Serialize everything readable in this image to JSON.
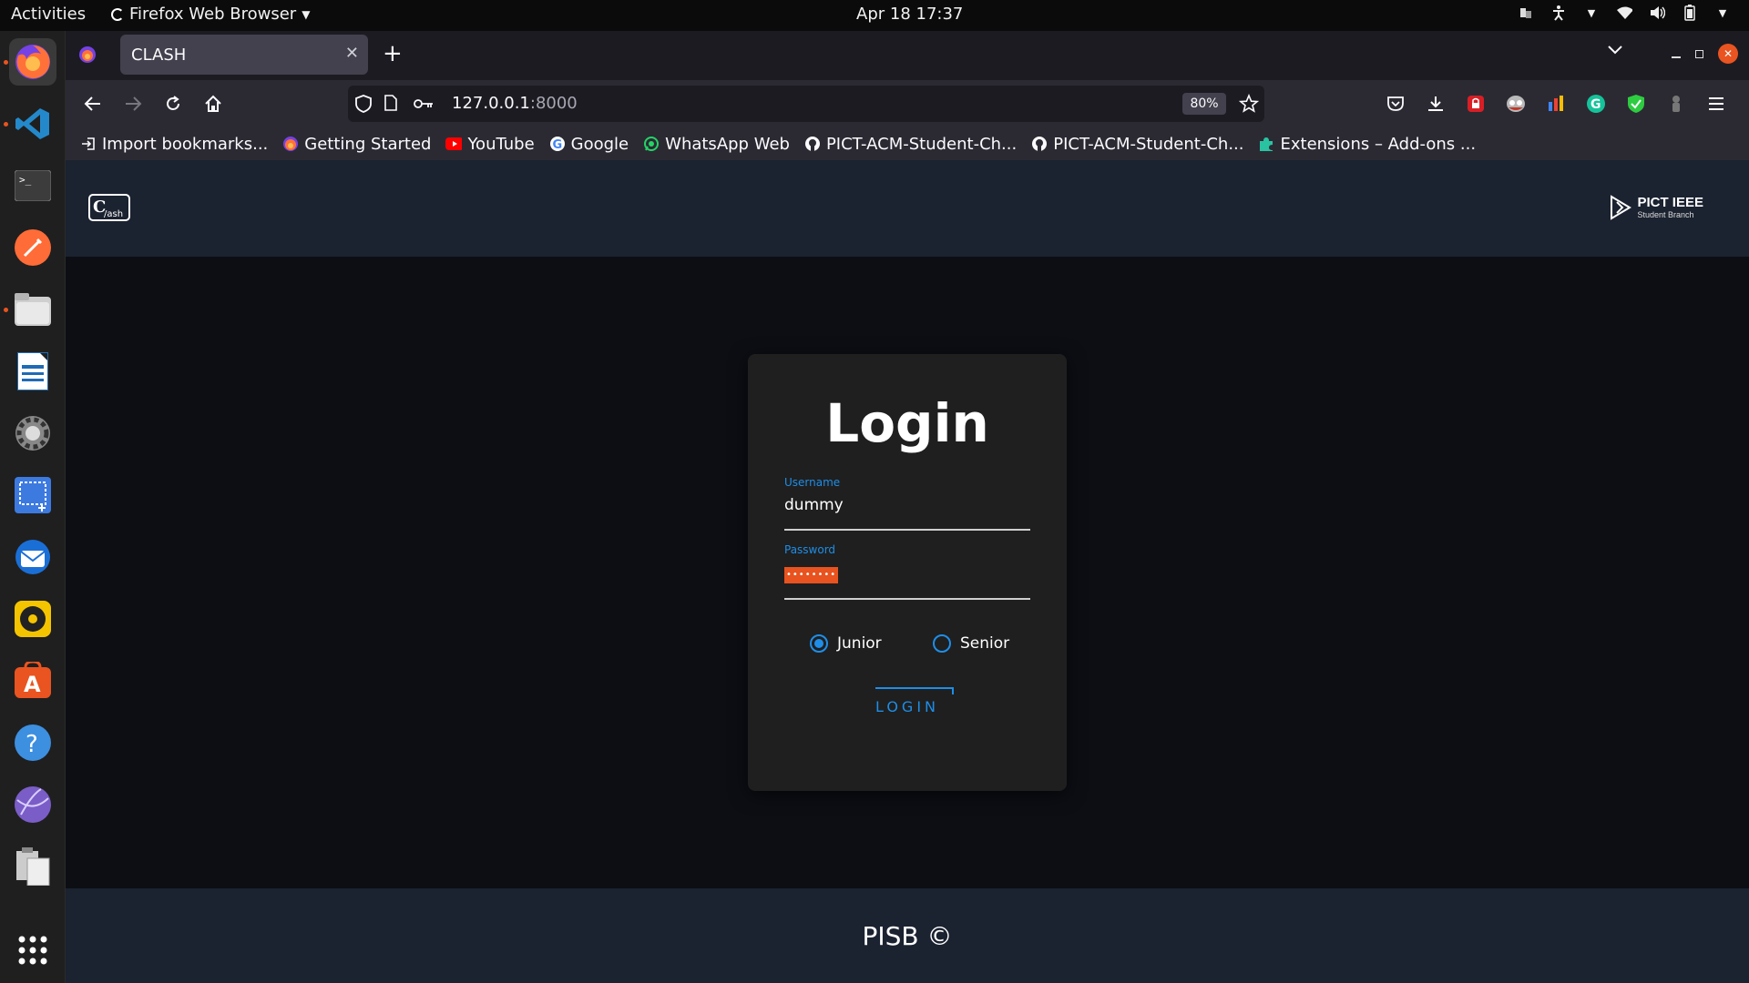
{
  "topbar": {
    "activities": "Activities",
    "app_name": "Firefox Web Browser",
    "clock": "Apr 18  17:37"
  },
  "dock": {
    "items": [
      "firefox",
      "vscode",
      "terminal",
      "postman",
      "files",
      "writer",
      "settings",
      "screenshot",
      "thunderbird",
      "rhythmbox",
      "app-center",
      "help",
      "internet",
      "clipboard",
      "show-apps"
    ]
  },
  "browser": {
    "tab_title": "CLASH",
    "url_host": "127.0.0.1",
    "url_port": ":8000",
    "zoom": "80%"
  },
  "bookmarks": [
    {
      "label": "Import bookmarks...",
      "icon": "import-icon"
    },
    {
      "label": "Getting Started",
      "icon": "firefox-icon"
    },
    {
      "label": "YouTube",
      "icon": "youtube-icon"
    },
    {
      "label": "Google",
      "icon": "google-icon"
    },
    {
      "label": "WhatsApp Web",
      "icon": "whatsapp-icon"
    },
    {
      "label": "PICT-ACM-Student-Ch...",
      "icon": "github-icon"
    },
    {
      "label": "PICT-ACM-Student-Ch...",
      "icon": "github-icon"
    },
    {
      "label": "Extensions – Add-ons ...",
      "icon": "puzzle-icon"
    }
  ],
  "site": {
    "header_logo": "C/ash",
    "ieee_title": "PICT IEEE",
    "ieee_sub": "Student Branch",
    "footer": "PISB ©"
  },
  "login": {
    "title": "Login",
    "username_label": "Username",
    "username_value": "dummy",
    "password_label": "Password",
    "password_mask": "••••••••",
    "radio_junior": "Junior",
    "radio_senior": "Senior",
    "selected": "Junior",
    "button": "LOGIN"
  },
  "colors": {
    "accent": "#1e8ee8",
    "header_bg": "#1b2230",
    "card_bg": "#1f1f1f",
    "page_bg": "#0c0e14",
    "password_highlight": "#e8531f"
  }
}
